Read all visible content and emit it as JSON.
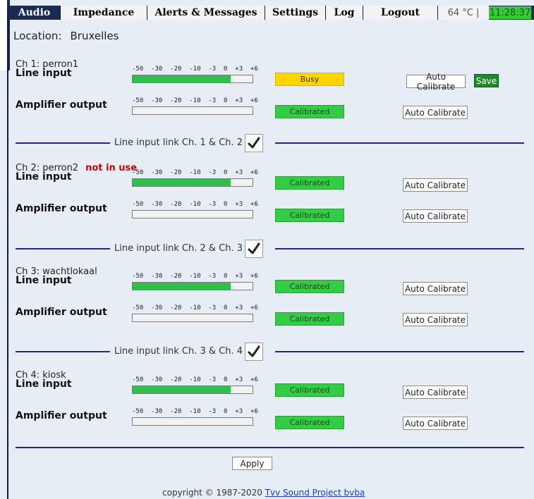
{
  "nav": {
    "tabs": [
      {
        "label": "Audio",
        "active": true
      },
      {
        "label": "Impedance",
        "active": false
      },
      {
        "label": "Alerts & Messages",
        "active": false
      },
      {
        "label": "Settings",
        "active": false
      },
      {
        "label": "Log",
        "active": false
      },
      {
        "label": "Logout",
        "active": false
      }
    ],
    "temperature": "64 °C |",
    "clock": "11:28:37"
  },
  "location": {
    "label": "Location:",
    "value": "Bruxelles"
  },
  "scale_text": "-50  -30  -20  -10  -3  0  +3  +6",
  "labels": {
    "line_input": "Line input",
    "amplifier_output": "Amplifier output",
    "auto_calibrate": "Auto Calibrate",
    "save": "Save"
  },
  "channels": [
    {
      "name": "Ch 1: perron1",
      "note": "",
      "line_input": {
        "level": 0.82,
        "status": "Busy"
      },
      "amplifier_output": {
        "level": 0,
        "status": "Calibrated"
      }
    },
    {
      "name": "Ch 2: perron2",
      "note": "not in use",
      "line_input": {
        "level": 0.82,
        "status": "Calibrated"
      },
      "amplifier_output": {
        "level": 0,
        "status": "Calibrated"
      }
    },
    {
      "name": "Ch 3: wachtlokaal",
      "note": "",
      "line_input": {
        "level": 0.82,
        "status": "Calibrated"
      },
      "amplifier_output": {
        "level": 0,
        "status": "Calibrated"
      }
    },
    {
      "name": "Ch 4: kiosk",
      "note": "",
      "line_input": {
        "level": 0.82,
        "status": "Calibrated"
      },
      "amplifier_output": {
        "level": 0,
        "status": "Calibrated"
      }
    }
  ],
  "links": [
    {
      "label": "Line input link Ch. 1 & Ch. 2",
      "checked": true
    },
    {
      "label": "Line input link Ch. 2 & Ch. 3",
      "checked": true
    },
    {
      "label": "Line input link Ch. 3 & Ch. 4",
      "checked": true
    }
  ],
  "apply_label": "Apply",
  "footer": {
    "text": "copyright © 1987-2020 ",
    "link": "Tvv Sound Project bvba"
  },
  "colors": {
    "nav_bg": "#1a2a55",
    "meter_fill": "#2fbf4f",
    "busy": "#ffd400",
    "calibrated": "#33cc44",
    "save": "#1e8a2a",
    "not_in_use": "#cc0000",
    "divider": "#1a2a8a"
  }
}
